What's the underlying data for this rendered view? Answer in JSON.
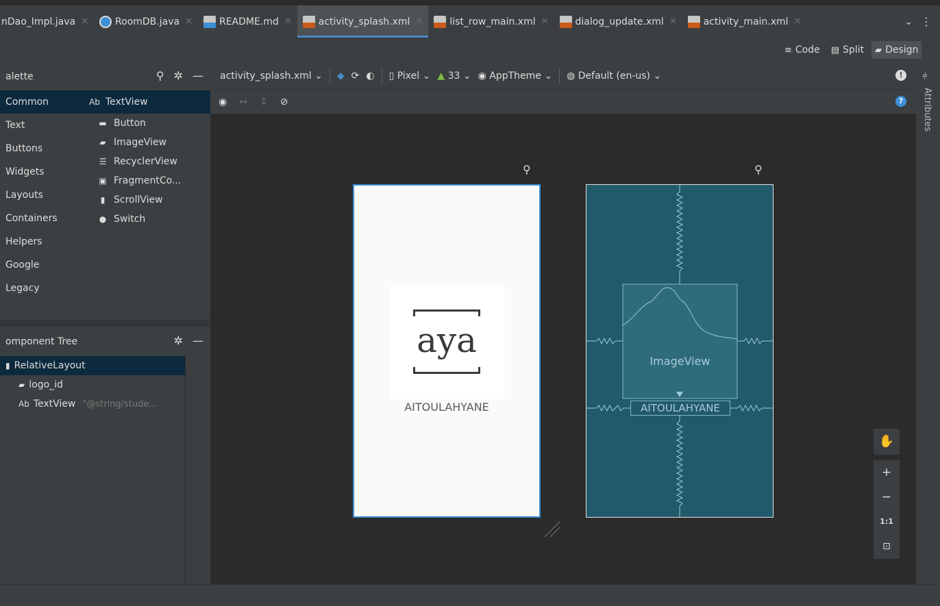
{
  "tabs": [
    {
      "label": "nDao_Impl.java",
      "icon": "java-icon",
      "active": false
    },
    {
      "label": "RoomDB.java",
      "icon": "interface-icon",
      "active": false
    },
    {
      "label": "README.md",
      "icon": "markdown-icon",
      "active": false
    },
    {
      "label": "activity_splash.xml",
      "icon": "layout-xml-icon",
      "active": true
    },
    {
      "label": "list_row_main.xml",
      "icon": "layout-xml-icon",
      "active": false
    },
    {
      "label": "dialog_update.xml",
      "icon": "layout-xml-icon",
      "active": false
    },
    {
      "label": "activity_main.xml",
      "icon": "layout-xml-icon",
      "active": false
    }
  ],
  "view_modes": {
    "code": "Code",
    "split": "Split",
    "design": "Design"
  },
  "palette": {
    "title": "alette",
    "categories": [
      "Common",
      "Text",
      "Buttons",
      "Widgets",
      "Layouts",
      "Containers",
      "Helpers",
      "Google",
      "Legacy"
    ],
    "items": [
      {
        "prefix": "Ab",
        "label": "TextView"
      },
      {
        "prefix": "▬",
        "label": "Button"
      },
      {
        "prefix": "▰",
        "label": "ImageView"
      },
      {
        "prefix": "☰",
        "label": "RecyclerView"
      },
      {
        "prefix": "▣",
        "label": "FragmentCo..."
      },
      {
        "prefix": "▮",
        "label": "ScrollView"
      },
      {
        "prefix": "●",
        "label": "Switch"
      }
    ]
  },
  "component_tree": {
    "title": "omponent Tree",
    "rows": [
      {
        "prefix": "▮",
        "label": "RelativeLayout",
        "hint": ""
      },
      {
        "prefix": "▰",
        "label": "logo_id",
        "hint": ""
      },
      {
        "prefix": "Ab",
        "label": "TextView",
        "hint": "\"@string/stude..."
      }
    ]
  },
  "design_toolbar": {
    "file": "activity_splash.xml",
    "device": "Pixel",
    "api": "33",
    "theme": "AppTheme",
    "locale": "Default (en-us)"
  },
  "screen": {
    "logo_text": "aya",
    "text": "AITOULAHYANE"
  },
  "blueprint": {
    "image_label": "ImageView",
    "text": "AITOULAHYANE"
  },
  "zoom": {
    "plus": "+",
    "minus": "−",
    "one_to_one": "1:1"
  },
  "attributes_label": "Attributes",
  "colors": {
    "accent": "#4a88c7",
    "blueprint": "#215a6b",
    "selection": "#0d293e"
  }
}
